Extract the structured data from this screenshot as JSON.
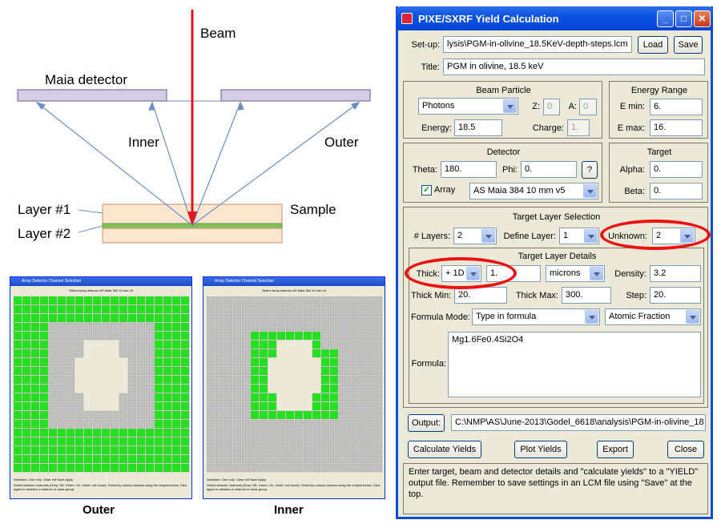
{
  "diagram": {
    "beam_label": "Beam",
    "detector_label": "Maia detector",
    "inner_label": "Inner",
    "outer_label": "Outer",
    "layer1_label": "Layer #1",
    "layer2_label": "Layer #2",
    "sample_label": "Sample",
    "colors": {
      "beam": "#e8141c",
      "detector": "#d4cde6",
      "ray": "#6b8fc4",
      "layer": "#fbe6d0",
      "layer2": "#7ec25a"
    }
  },
  "grids": {
    "outer_caption": "Outer",
    "inner_caption": "Inner",
    "window_title": "Array Detector Channel Selection",
    "select_label": "Select Array detector",
    "detector_value": "AS Maia 384 10 mm v5",
    "selection_label": "Selection",
    "selection_value": "One only",
    "buttons": [
      "Clear",
      "Init",
      "Save",
      "Apply"
    ],
    "help_text": "Select detector channels (Grey: Off, Green: On, Violet: not found). Select by various classes using the droplist below. Click again to deselect a channel or class group.",
    "colors": {
      "on": "#22e21d",
      "off": "#c0c0c0"
    }
  },
  "dialog": {
    "title": "PIXE/SXRF Yield Calculation",
    "setup_label": "Set-up:",
    "setup_value": "lysis\\PGM-in-olivine_18.5KeV-depth-steps.lcm",
    "load_button": "Load",
    "save_button": "Save",
    "title_label": "Title:",
    "title_value": "PGM in olivine, 18.5 keV",
    "beam": {
      "header": "Beam Particle",
      "particle": "Photons",
      "z_label": "Z:",
      "z_value": "0",
      "a_label": "A:",
      "a_value": "0",
      "energy_label": "Energy:",
      "energy_value": "18.5",
      "charge_label": "Charge:",
      "charge_value": "1."
    },
    "energy_range": {
      "header": "Energy Range",
      "emin_label": "E min:",
      "emin_value": "6.",
      "emax_label": "E max:",
      "emax_value": "16."
    },
    "detector": {
      "header": "Detector",
      "theta_label": "Theta:",
      "theta_value": "180.",
      "phi_label": "Phi:",
      "phi_value": "0.",
      "help_button": "?",
      "array_label": "Array",
      "array_checked": true,
      "array_value": "AS Maia 384 10 mm v5"
    },
    "target": {
      "header": "Target",
      "alpha_label": "Alpha:",
      "alpha_value": "0.",
      "beta_label": "Beta:",
      "beta_value": "0."
    },
    "layer_selection": {
      "header": "Target Layer Selection",
      "layers_label": "# Layers:",
      "layers_value": "2",
      "define_label": "Define Layer:",
      "define_value": "1",
      "unknown_label": "Unknown:",
      "unknown_value": "2"
    },
    "layer_details": {
      "header": "Target Layer Details",
      "thick_label": "Thick:",
      "thick_mode": "+ 1D",
      "thick_value": "1.",
      "units": "microns",
      "density_label": "Density:",
      "density_value": "3.2",
      "thick_min_label": "Thick Min:",
      "thick_min_value": "20.",
      "thick_max_label": "Thick Max:",
      "thick_max_value": "300.",
      "step_label": "Step:",
      "step_value": "20.",
      "formula_mode_label": "Formula Mode:",
      "formula_mode_value": "Type in formula",
      "fraction_value": "Atomic Fraction",
      "formula_label": "Formula:",
      "formula_value": "Mg1.6Fe0.4Si2O4"
    },
    "output_button": "Output:",
    "output_value": "C:\\NMP\\AS\\June-2013\\Godel_6618\\analysis\\PGM-in-olivine_18",
    "calc_button": "Calculate Yields",
    "plot_button": "Plot Yields",
    "export_button": "Export",
    "close_button": "Close",
    "help_text": "Enter target, beam and detector details and \"calculate yields\" to a \"YIELD\" output file. Remember to save settings in an LCM file using \"Save\" at the top."
  }
}
